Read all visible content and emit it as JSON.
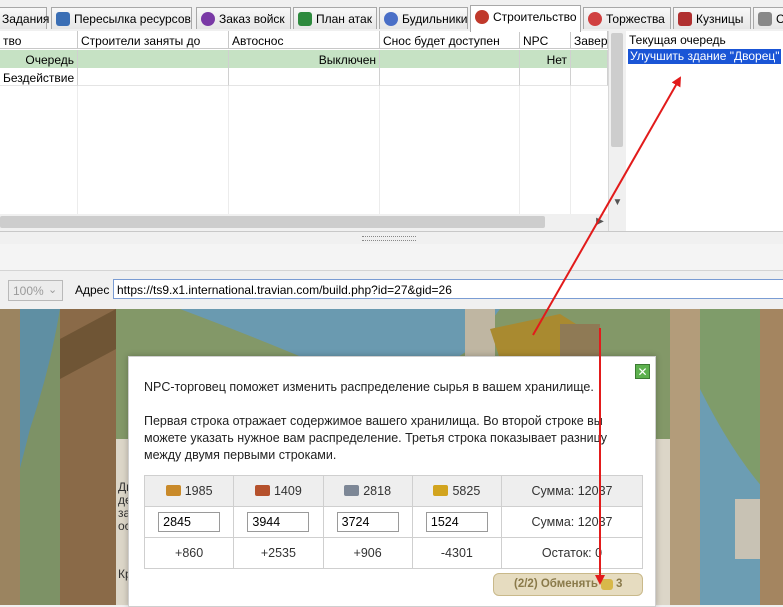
{
  "tabs": [
    {
      "label": "Задания",
      "icon": "tasks-icon"
    },
    {
      "label": "Пересылка ресурсов",
      "icon": "resources-transfer-icon"
    },
    {
      "label": "Заказ войск",
      "icon": "troops-order-icon"
    },
    {
      "label": "План атак",
      "icon": "attack-plan-icon"
    },
    {
      "label": "Будильники",
      "icon": "alarm-icon"
    },
    {
      "label": "Строительство",
      "icon": "construction-icon",
      "active": true
    },
    {
      "label": "Торжества",
      "icon": "celebrations-icon"
    },
    {
      "label": "Кузницы",
      "icon": "smithy-icon"
    },
    {
      "label": "С",
      "icon": "more-tab-icon"
    }
  ],
  "grid": {
    "columns": [
      "тво",
      "Строители заняты до",
      "Автоснос",
      "Снос будет доступен",
      "NPC",
      "Заверш"
    ],
    "rows": [
      [
        "Очередь",
        "",
        "Выключен",
        "",
        "Нет",
        ""
      ],
      [
        "Бездействие",
        "",
        "",
        "",
        "",
        ""
      ]
    ]
  },
  "queue_panel": {
    "title": "Текущая очередь",
    "items": [
      "Улучшить здание \"Дворец\""
    ]
  },
  "address_bar": {
    "zoom": "100%",
    "label": "Адрес",
    "url": "https://ts9.x1.international.travian.com/build.php?id=27&gid=26"
  },
  "npc_dialog": {
    "intro": "NPC-торговец поможет изменить распределение сырья в вашем хранилище.",
    "line1": "Первая строка отражает содержимое вашего хранилища. Во второй строке вы",
    "line2": "можете указать нужное вам распределение. Третья строка показывает разницу",
    "line3": "между двумя первыми строками.",
    "current": [
      "1985",
      "1409",
      "2818",
      "5825"
    ],
    "current_sum": "Сумма: 12037",
    "desired": [
      "2845",
      "3944",
      "3724",
      "1524"
    ],
    "desired_sum": "Сумма: 12037",
    "diff": [
      "+860",
      "+2535",
      "+906",
      "-4301"
    ],
    "remaining": "Остаток: 0",
    "exchange_label": "(2/2) Обменять",
    "exchange_cost": "3"
  },
  "background_text": {
    "left_lines": [
      "Дв",
      "де",
      "зак",
      "осн"
    ],
    "lower": "Кр"
  },
  "colors": {
    "selected_row": "#c6e2c4",
    "queue_highlight": "#1a55d6",
    "arrow": "#e21b1b",
    "exchange_button": "#e6dcc0"
  }
}
